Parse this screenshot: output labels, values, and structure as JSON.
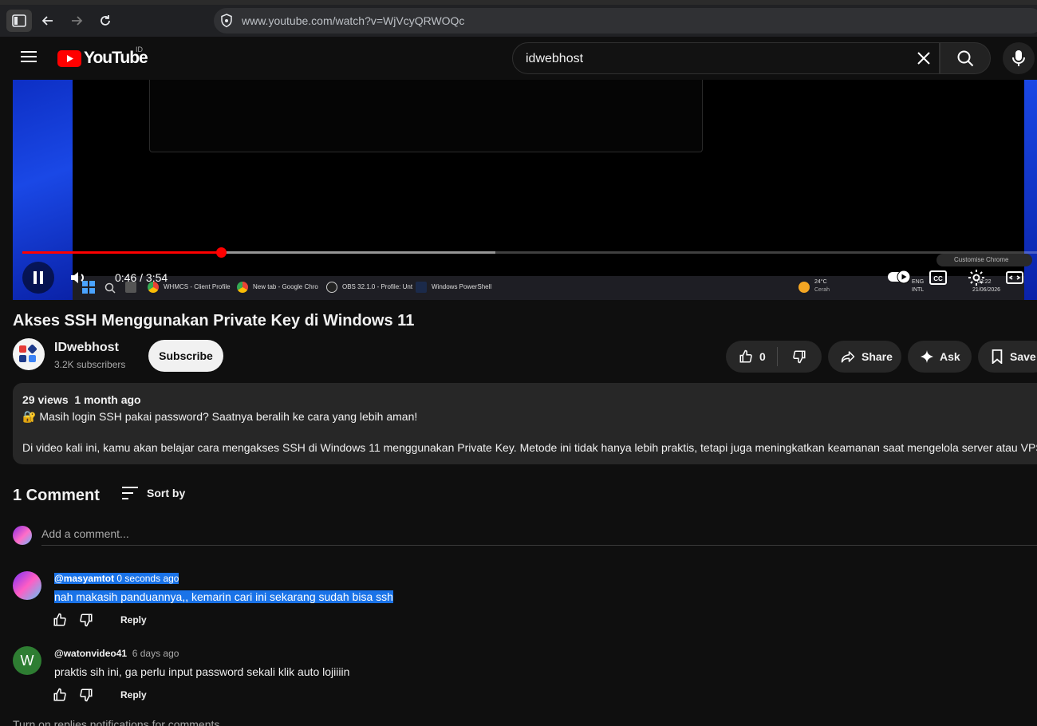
{
  "browser": {
    "url": "www.youtube.com/watch?v=WjVcyQRWOQc"
  },
  "header": {
    "logo_text": "YouTube",
    "country_code": "ID",
    "search_query": "idwebhost"
  },
  "player": {
    "current_time": "0:46",
    "duration": "3:54",
    "time_display": "0:46 / 3:54",
    "played_fraction": 0.196,
    "buffered_fraction": 0.466,
    "autoplay_on": true,
    "taskbar": {
      "items": [
        "WHMCS - Client Profile",
        "New tab - Google Chro",
        "OBS 32.1.0 - Profile: Unt",
        "Windows PowerShell"
      ],
      "weather_temp": "24°C",
      "weather_text": "Cerah",
      "lang_top": "ENG",
      "lang_bottom": "INTL",
      "clock_time": "03:22",
      "clock_date": "21/06/2026",
      "customise_chrome": "Customise Chrome"
    }
  },
  "video": {
    "title": "Akses SSH Menggunakan Private Key di Windows 11",
    "channel_name": "IDwebhost",
    "subscribers": "3.2K subscribers",
    "subscribe_label": "Subscribe",
    "like_count": "0",
    "share_label": "Share",
    "ask_label": "Ask",
    "save_label": "Save"
  },
  "description": {
    "views": "29 views",
    "date": "1 month ago",
    "line1": "🔐 Masih login SSH pakai password? Saatnya beralih ke cara yang lebih aman!",
    "line2": "Di video kali ini, kamu akan belajar cara mengakses SSH di Windows 11 menggunakan Private Key. Metode ini tidak hanya lebih praktis, tetapi juga meningkatkan keamanan saat mengelola server atau VPS."
  },
  "comments": {
    "count_label": "1 Comment",
    "sort_label": "Sort by",
    "add_placeholder": "Add a comment...",
    "reply_label": "Reply",
    "items": [
      {
        "author": "@masyamtot",
        "time": "0 seconds ago",
        "text": "nah makasih panduannya,, kemarin cari ini sekarang sudah bisa ssh"
      },
      {
        "author": "@watonvideo41",
        "time": "6 days ago",
        "text": "praktis sih ini, ga perlu input password sekali klik auto lojiiiin",
        "avatar_letter": "W"
      }
    ],
    "footer_partial": "Turn on replies notifications for comments"
  },
  "colors": {
    "background": "#0f0f0f",
    "accent_red": "#ff0000",
    "pill_bg": "#272727",
    "selection": "#1a73e8",
    "avatar_green": "#2e7d32"
  }
}
